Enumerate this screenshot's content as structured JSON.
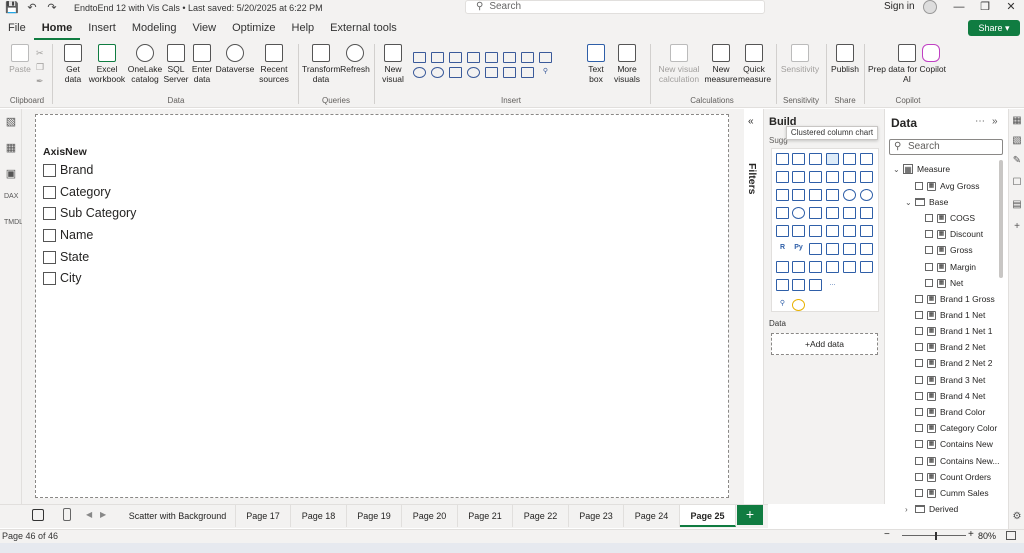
{
  "title_bar": {
    "doc_title": "EndtoEnd 12 with Vis Cals • Last saved: 5/20/2025 at 6:22 PM",
    "search_placeholder": "Search",
    "sign_in": "Sign in"
  },
  "menu": {
    "items": [
      "File",
      "Home",
      "Insert",
      "Modeling",
      "View",
      "Optimize",
      "Help",
      "External tools"
    ],
    "active": "Home",
    "share": "Share"
  },
  "ribbon": {
    "clipboard": {
      "paste": "Paste",
      "group": "Clipboard"
    },
    "data": {
      "get_data": "Get\ndata",
      "excel": "Excel\nworkbook",
      "onelake": "OneLake\ncatalog",
      "sql": "SQL\nServer",
      "enter": "Enter\ndata",
      "dataverse": "Dataverse",
      "recent": "Recent\nsources",
      "group": "Data"
    },
    "queries": {
      "transform": "Transform\ndata",
      "refresh": "Refresh",
      "group": "Queries"
    },
    "insert": {
      "new_visual": "New\nvisual",
      "text_box": "Text\nbox",
      "more_visuals": "More\nvisuals",
      "group": "Insert"
    },
    "calculations": {
      "new_visual_calc": "New visual\ncalculation",
      "new_measure": "New\nmeasure",
      "quick_measure": "Quick\nmeasure",
      "group": "Calculations"
    },
    "sensitivity": {
      "label": "Sensitivity",
      "group": "Sensitivity"
    },
    "share": {
      "publish": "Publish",
      "group": "Share"
    },
    "copilot": {
      "prep": "Prep data for Copilot\nAI",
      "copilot": "Copilot",
      "group": "Copilot"
    }
  },
  "slicer": {
    "title": "AxisNew",
    "items": [
      "Brand",
      "Category",
      "Sub Category",
      "Name",
      "State",
      "City"
    ]
  },
  "filters": {
    "label": "Filters"
  },
  "build": {
    "title": "Build",
    "tooltip": "Clustered column chart",
    "suggest": "Sugg",
    "data_label": "Data",
    "add_data": "+Add data",
    "viz_icons": [
      "R",
      "Py",
      "..."
    ]
  },
  "data_pane": {
    "title": "Data",
    "search_placeholder": "Search",
    "measure_table": "Measure",
    "avg_gross": "Avg Gross",
    "base_folder": "Base",
    "base_items": [
      "COGS",
      "Discount",
      "Gross",
      "Margin",
      "Net"
    ],
    "measures": [
      "Brand 1 Gross",
      "Brand 1 Net",
      "Brand 1 Net 1",
      "Brand 2 Net",
      "Brand 2 Net 2",
      "Brand 3 Net",
      "Brand 4 Net",
      "Brand Color",
      "Category Color",
      "Contains New",
      "Contains New...",
      "Count Orders",
      "Cumm Sales"
    ],
    "derived_folder": "Derived"
  },
  "page_tabs": {
    "tabs": [
      "Scatter with Background",
      "Page 17",
      "Page 18",
      "Page 19",
      "Page 20",
      "Page 21",
      "Page 22",
      "Page 23",
      "Page 24",
      "Page 25"
    ],
    "active": "Page 25",
    "add": "+"
  },
  "status": {
    "page_count": "Page 46 of 46",
    "zoom": "80%"
  }
}
